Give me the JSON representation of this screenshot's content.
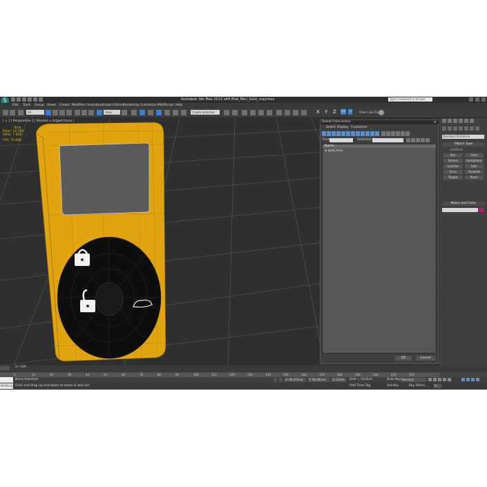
{
  "app": {
    "window_title": "Autodesk 3ds Max  2012 x64     iPod_Mini_Gold_vray.max",
    "logo_text": "S",
    "search_placeholder": "Type a keyword or phrase"
  },
  "menu": [
    "Edit",
    "Tools",
    "Group",
    "Views",
    "Create",
    "Modifiers",
    "Animation",
    "Graph Editors",
    "Rendering",
    "Customize",
    "MAXScript",
    "Help"
  ],
  "toolbar": {
    "filter": "All",
    "ref_coord": "View",
    "selection_set": "Create Selection",
    "axis_x": "X",
    "axis_y": "Y",
    "axis_z": "Z",
    "axis_xy": "XY",
    "view_cube": "View Cube Tools"
  },
  "viewport": {
    "label": "[ + ] [ Perspective ] [ Shaded + Edged Faces ]",
    "stats_header": "Total",
    "polys_label": "Polys:",
    "polys_value": "14 760",
    "verts_label": "Verts:",
    "verts_value": "7 850",
    "fps_label": "FPS:",
    "fps_value": "72.600"
  },
  "command_panel": {
    "category": "Standard Primitives",
    "object_type": "Object Type",
    "autogrid": "AutoGrid",
    "primitives": [
      "Box",
      "Cone",
      "Sphere",
      "GeoSphere",
      "Cylinder",
      "Tube",
      "Torus",
      "Pyramid",
      "Teapot",
      "Plane"
    ],
    "name_and_color": "Name and Color",
    "object_color": "#c0177d"
  },
  "dialog": {
    "title": "Select From Scene",
    "close": "×",
    "menu": [
      "Select",
      "Display",
      "Customize"
    ],
    "find_label": "Find:",
    "selection_set_label": "Selection Set:",
    "column_name": "Name",
    "items": [
      "ipod_mini"
    ],
    "ok": "OK",
    "cancel": "Cancel"
  },
  "timeline": {
    "frame": "0 / 100",
    "ticks": [
      "0",
      "10",
      "20",
      "30",
      "40",
      "50",
      "60",
      "70",
      "80",
      "90",
      "100",
      "110",
      "120",
      "130",
      "140",
      "150",
      "160",
      "170",
      "180",
      "190",
      "200",
      "210",
      "220"
    ]
  },
  "status": {
    "maxscript": "MAXScript",
    "selection": "None Selected",
    "prompt": "Click and drag up-and-down to zoom in and out",
    "x": "X: 46.471cm",
    "y": "Y: 58.481cm",
    "z": "Z: 0.0cm",
    "grid": "Grid = 10.0cm",
    "auto_key": "Auto Key",
    "selected": "Selected",
    "set_key": "Set Key",
    "key_filters": "Key Filters...",
    "add_time_tag": "Add Time Tag",
    "frame_value": "0"
  }
}
